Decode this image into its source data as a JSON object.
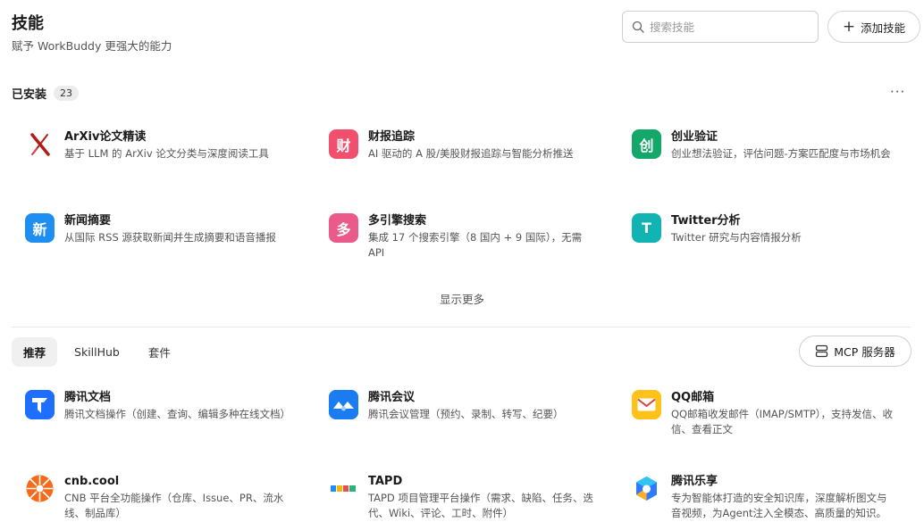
{
  "header": {
    "title": "技能",
    "subtitle": "赋予 WorkBuddy 更强大的能力",
    "search_placeholder": "搜索技能",
    "add_label": "添加技能"
  },
  "installed": {
    "label": "已安装",
    "count": "23",
    "more": "···",
    "show_more": "显示更多",
    "items": [
      {
        "name": "ArXiv论文精读",
        "desc": "基于 LLM 的 ArXiv 论文分类与深度阅读工具",
        "icon_char": "X",
        "icon": "arxiv-icon",
        "color": "#b31b1b"
      },
      {
        "name": "财报追踪",
        "desc": "AI 驱动的 A 股/美股财报追踪与智能分析推送",
        "icon_char": "财",
        "icon": "finance-report-icon",
        "color": "#f0506e"
      },
      {
        "name": "创业验证",
        "desc": "创业想法验证，评估问题-方案匹配度与市场机会",
        "icon_char": "创",
        "icon": "startup-icon",
        "color": "#13a86a"
      },
      {
        "name": "新闻摘要",
        "desc": "从国际 RSS 源获取新闻并生成摘要和语音播报",
        "icon_char": "新",
        "icon": "news-icon",
        "color": "#1e8ff0"
      },
      {
        "name": "多引擎搜索",
        "desc": "集成 17 个搜索引擎（8 国内 + 9 国际），无需 API",
        "icon_char": "多",
        "icon": "multi-search-icon",
        "color": "#ea5a8a"
      },
      {
        "name": "Twitter分析",
        "desc": "Twitter 研究与内容情报分析",
        "icon_char": "T",
        "icon": "twitter-analysis-icon",
        "color": "#12b3b3"
      }
    ]
  },
  "recommend": {
    "tabs": [
      "推荐",
      "SkillHub",
      "套件"
    ],
    "mcp_label": "MCP 服务器",
    "items": [
      {
        "name": "腾讯文档",
        "desc": "腾讯文档操作（创建、查询、编辑多种在线文档）",
        "icon": "tencent-docs-icon"
      },
      {
        "name": "腾讯会议",
        "desc": "腾讯会议管理（预约、录制、转写、纪要）",
        "icon": "tencent-meeting-icon"
      },
      {
        "name": "QQ邮箱",
        "desc": "QQ邮箱收发邮件（IMAP/SMTP），支持发信、收信、查看正文",
        "icon": "qq-mail-icon"
      },
      {
        "name": "cnb.cool",
        "desc": "CNB 平台全功能操作（仓库、Issue、PR、流水线、制品库）",
        "icon": "cnb-icon"
      },
      {
        "name": "TAPD",
        "desc": "TAPD 项目管理平台操作（需求、缺陷、任务、迭代、Wiki、评论、工时、附件）",
        "icon": "tapd-icon"
      },
      {
        "name": "腾讯乐享",
        "desc": "专为智能体打造的安全知识库，深度解析图文与音视频，为Agent注入全模态、高质量的知识。",
        "icon": "tencent-lexiang-icon"
      }
    ]
  }
}
